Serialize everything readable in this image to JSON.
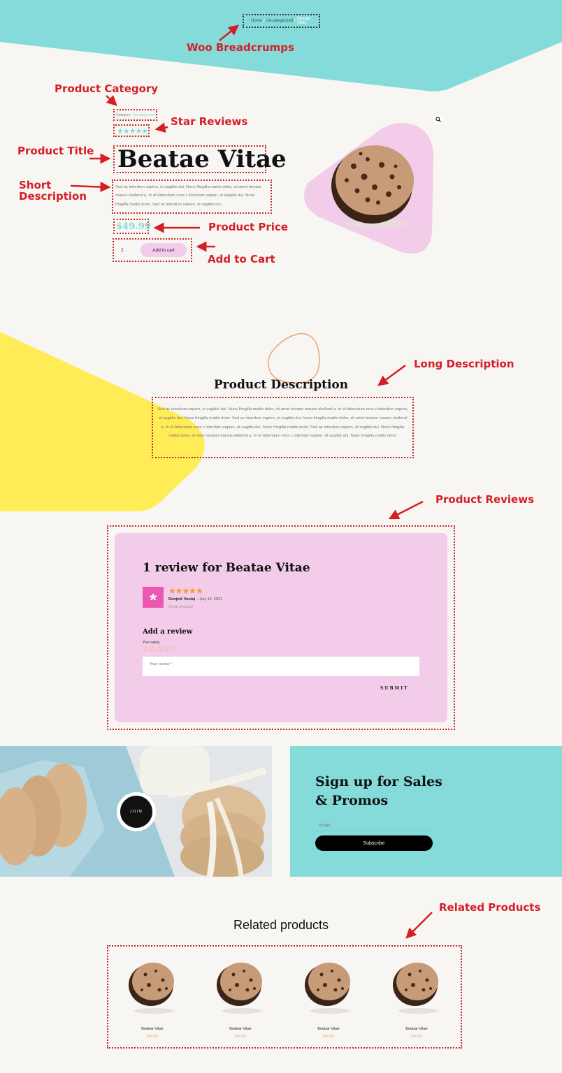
{
  "colors": {
    "teal": "#84dbd9",
    "pink": "#f2cce8",
    "yellow": "#ffec57",
    "annotation_red": "#d41f26",
    "price_teal": "#84dbd9",
    "orange_star": "#f49b2e",
    "avatar_pink": "#ec58b0"
  },
  "breadcrumb": {
    "items": [
      "Home",
      "Uncategorized",
      "Beatae Vitae"
    ],
    "separator": "/"
  },
  "product": {
    "category_label": "Category:",
    "category_value": "Uncategorized",
    "rating_stars": 5,
    "title": "Beatae Vitae",
    "short_description": "Sed ac interdum sapien, et sagittis dui. Nunc fringilla mattis dolor, sit amet tempor mauris eleifend a. In et bibendum eros c interdum sapien, et sagittis dui. Nunc fringilla mattis dolor. Sed ac interdum sapien, et sagittis dui.",
    "price": "$49.99",
    "quantity": "1",
    "add_to_cart_label": "Add to cart",
    "zoom_icon": "magnifier-icon"
  },
  "description": {
    "heading": "Product Description",
    "body": "Sed ac interdum sapien, et sagittis dui. Nunc fringilla mattis dolor, sit amet tempor mauris eleifend a. In et bibendum eros c interdum sapien, et sagittis dui. Nunc fringilla mattis dolor. Sed ac interdum sapien, et sagittis dui. Nunc fringilla mattis dolor, sit amet tempor mauris eleifend a. In et bibendum eros c interdum sapien, et sagittis dui. Nunc fringilla mattis dolor. Sed ac interdum sapien, et sagittis dui. Nunc fringilla mattis dolor, sit amet tempor mauris eleifend a. In et bibendum eros c interdum sapien, et sagittis dui. Nunc fringilla mattis dolor."
  },
  "reviews": {
    "heading": "1 review for Beatae Vitae",
    "items": [
      {
        "stars": 5,
        "author": "Donjetë Vuniqi",
        "date": "July 14, 2021",
        "text": "Great product!"
      }
    ],
    "add_review_heading": "Add a review",
    "your_rating_label": "Your rating",
    "review_placeholder": "Your review *",
    "submit_label": "SUBMIT"
  },
  "signup": {
    "join_label": "JOIN",
    "heading_line1": "Sign up for Sales",
    "heading_line2": "& Promos",
    "email_placeholder": "Email",
    "subscribe_label": "Subscribe"
  },
  "related": {
    "heading": "Related products",
    "items": [
      {
        "name": "Beatae Vitae",
        "price": "$49.99"
      },
      {
        "name": "Beatae Vitae",
        "price": "$49.99"
      },
      {
        "name": "Beatae Vitae",
        "price": "$49.99"
      },
      {
        "name": "Beatae Vitae",
        "price": "$49.99"
      }
    ]
  },
  "annotations": {
    "breadcrumbs": "Woo Breadcrumps",
    "category": "Product Category",
    "stars": "Star Reviews",
    "title_line": "Product Title",
    "short_desc_1": "Short",
    "short_desc_2": "Description",
    "price": "Product Price",
    "cart": "Add to Cart",
    "long_desc": "Long Description",
    "reviews": "Product Reviews",
    "related": "Related Products"
  }
}
